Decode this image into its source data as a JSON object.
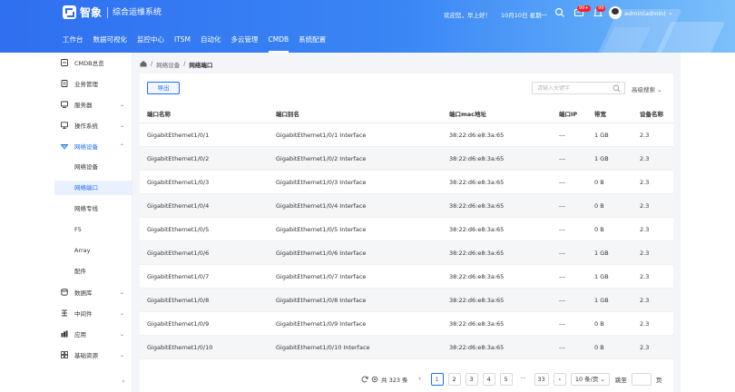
{
  "header": {
    "brand": "智象",
    "system_name": "综合运维系统",
    "greeting": "欢迎您，早上好！",
    "date": "10月10日 星期一",
    "badge_notify": "99+",
    "badge_mail": "99",
    "user": "admin(admin)",
    "nav": [
      "工作台",
      "数据可视化",
      "监控中心",
      "ITSM",
      "自动化",
      "多云管理",
      "CMDB",
      "系统配置"
    ],
    "active_nav": "CMDB"
  },
  "sidebar": {
    "items": [
      {
        "label": "CMDB总览",
        "icon": "overview-icon"
      },
      {
        "label": "业务管理",
        "icon": "business-icon"
      },
      {
        "label": "服务器",
        "icon": "server-icon",
        "arrow": "⌄"
      },
      {
        "label": "操作系统",
        "icon": "monitor-icon",
        "arrow": "⌄"
      },
      {
        "label": "网络设备",
        "icon": "wifi-icon",
        "arrow": "⌃"
      }
    ],
    "subitems": [
      "网络设备",
      "网络端口",
      "网络专线",
      "F5",
      "Array",
      "配件"
    ],
    "active_sub": "网络端口",
    "items_after": [
      {
        "label": "数据库",
        "icon": "database-icon",
        "arrow": "⌄"
      },
      {
        "label": "中间件",
        "icon": "middleware-icon",
        "arrow": "⌄"
      },
      {
        "label": "应用",
        "icon": "app-icon",
        "arrow": "⌄"
      },
      {
        "label": "基础资源",
        "icon": "grid-icon",
        "arrow": "⌄"
      }
    ],
    "collapse": "«"
  },
  "breadcrumb": {
    "home_icon": "home-icon",
    "parent": "网络设备",
    "sep": "/",
    "current": "网络端口"
  },
  "toolbar": {
    "export_label": "导出",
    "search_placeholder": "请输入关键字",
    "advanced_label": "高级搜索 ⌄"
  },
  "table": {
    "columns": [
      "端口名称",
      "端口别名",
      "端口mac地址",
      "端口IP",
      "带宽",
      "设备名称"
    ],
    "rows": [
      [
        "GigabitEthernet1/0/1",
        "GigabitEthernet1/0/1 Interface",
        "38:22:d6:e8:3a:65",
        "---",
        "1 GB",
        "2.3"
      ],
      [
        "GigabitEthernet1/0/2",
        "GigabitEthernet1/0/2 Interface",
        "38:22:d6:e8:3a:65",
        "---",
        "1 GB",
        "2.3"
      ],
      [
        "GigabitEthernet1/0/3",
        "GigabitEthernet1/0/3 Interface",
        "38:22:d6:e8:3a:65",
        "---",
        "0 B",
        "2.3"
      ],
      [
        "GigabitEthernet1/0/4",
        "GigabitEthernet1/0/4 Interface",
        "38:22:d6:e8:3a:65",
        "---",
        "0 B",
        "2.3"
      ],
      [
        "GigabitEthernet1/0/5",
        "GigabitEthernet1/0/5 Interface",
        "38:22:d6:e8:3a:65",
        "---",
        "0 B",
        "2.3"
      ],
      [
        "GigabitEthernet1/0/6",
        "GigabitEthernet1/0/6 Interface",
        "38:22:d6:e8:3a:65",
        "---",
        "1 GB",
        "2.3"
      ],
      [
        "GigabitEthernet1/0/7",
        "GigabitEthernet1/0/7 Interface",
        "38:22:d6:e8:3a:65",
        "---",
        "1 GB",
        "2.3"
      ],
      [
        "GigabitEthernet1/0/8",
        "GigabitEthernet1/0/8 Interface",
        "38:22:d6:e8:3a:65",
        "---",
        "1 GB",
        "2.3"
      ],
      [
        "GigabitEthernet1/0/9",
        "GigabitEthernet1/0/9 Interface",
        "38:22:d6:e8:3a:65",
        "---",
        "0 B",
        "2.3"
      ],
      [
        "GigabitEthernet1/0/10",
        "GigabitEthernet1/0/10 Interface",
        "38:22:d6:e8:3a:65",
        "---",
        "0 B",
        "2.3"
      ]
    ]
  },
  "pager": {
    "total": "共 323 条",
    "prev": "‹",
    "pages": [
      "1",
      "2",
      "3",
      "4",
      "5"
    ],
    "ellipsis": "···",
    "last": "33",
    "next": "›",
    "page_size": "10 条/页 ⌄",
    "goto_label": "跳至",
    "page_unit": "页",
    "current": "1"
  },
  "colors": {
    "primary": "#1d6ef5",
    "header_start": "#2f6ff0",
    "header_end": "#7cc0fb"
  }
}
